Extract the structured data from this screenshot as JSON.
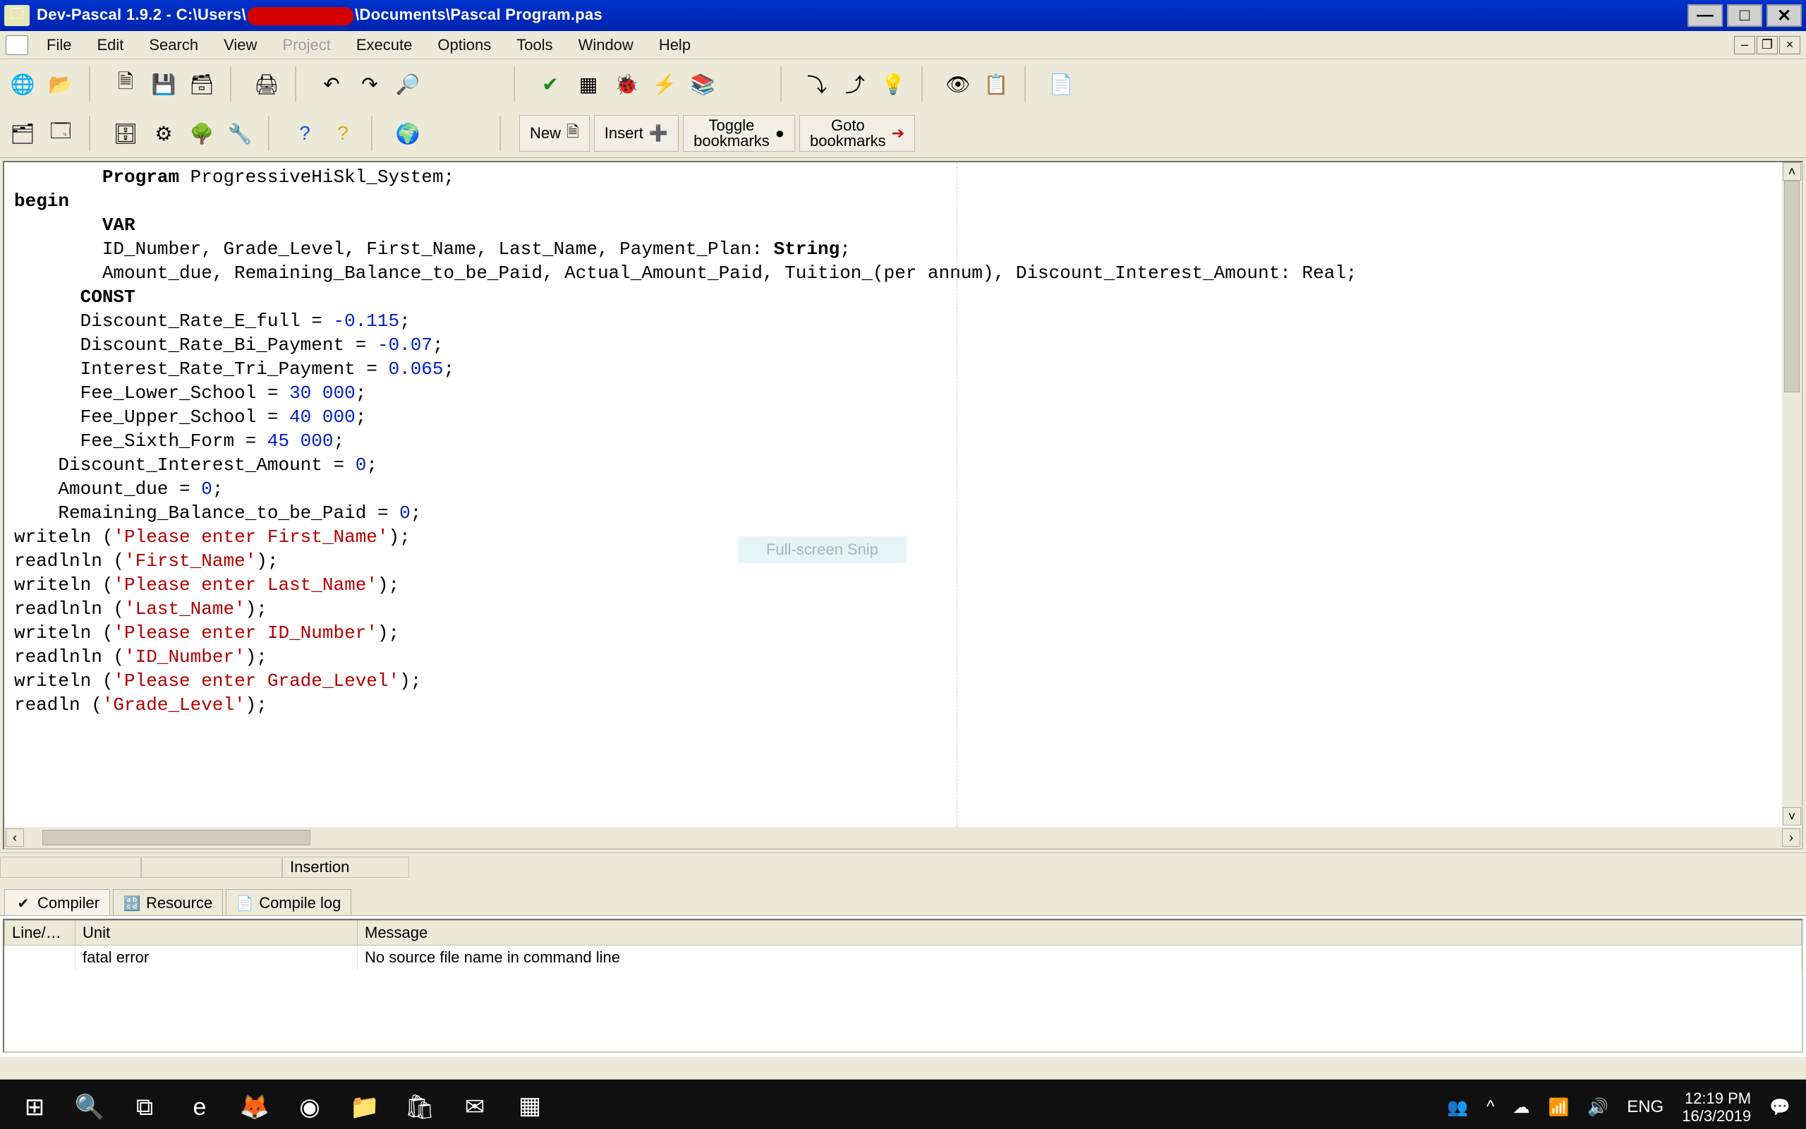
{
  "title": {
    "app": "Dev-Pascal 1.9.2",
    "path_prefix": " - C:\\Users\\",
    "path_suffix": "\\Documents\\Pascal Program.pas"
  },
  "menus": [
    "File",
    "Edit",
    "Search",
    "View",
    "Project",
    "Execute",
    "Options",
    "Tools",
    "Window",
    "Help"
  ],
  "menu_disabled_index": 4,
  "toolbar2": {
    "new": "New",
    "insert": "Insert",
    "toggle": "Toggle\nbookmarks",
    "goto": "Goto\nbookmarks"
  },
  "snip_hint": "Full-screen Snip",
  "status": {
    "mode": "Insertion"
  },
  "bottom_tabs": [
    {
      "icon": "✔",
      "label": "Compiler",
      "name": "tab-compiler"
    },
    {
      "icon": "🔡",
      "label": "Resource",
      "name": "tab-resource"
    },
    {
      "icon": "📄",
      "label": "Compile log",
      "name": "tab-compile-log"
    }
  ],
  "messages": {
    "columns": [
      "Line/…",
      "Unit",
      "Message"
    ],
    "rows": [
      {
        "line": "",
        "unit": "fatal error",
        "message": "No source file name in command line"
      }
    ]
  },
  "code_lines": [
    {
      "indent": 4,
      "tokens": [
        {
          "t": "Program ",
          "c": "kword"
        },
        {
          "t": "ProgressiveHiSkl_System;"
        }
      ]
    },
    {
      "indent": 0,
      "tokens": []
    },
    {
      "indent": 0,
      "tokens": [
        {
          "t": "begin",
          "c": "kword"
        }
      ]
    },
    {
      "indent": 0,
      "tokens": []
    },
    {
      "indent": 4,
      "tokens": [
        {
          "t": "VAR",
          "c": "kword"
        }
      ]
    },
    {
      "indent": 4,
      "tokens": [
        {
          "t": "ID_Number, Grade_Level, First_Name, Last_Name, Payment_Plan: "
        },
        {
          "t": "String",
          "c": "kword"
        },
        {
          "t": ";"
        }
      ]
    },
    {
      "indent": 4,
      "tokens": [
        {
          "t": "Amount_due, Remaining_Balance_to_be_Paid, Actual_Amount_Paid, Tuition_(per annum), Discount_Interest_Amount: Real;"
        }
      ]
    },
    {
      "indent": 0,
      "tokens": []
    },
    {
      "indent": 3,
      "tokens": [
        {
          "t": "CONST",
          "c": "kword"
        }
      ]
    },
    {
      "indent": 3,
      "tokens": [
        {
          "t": "Discount_Rate_E_full = "
        },
        {
          "t": "-0.115",
          "c": "num"
        },
        {
          "t": ";"
        }
      ]
    },
    {
      "indent": 3,
      "tokens": [
        {
          "t": "Discount_Rate_Bi_Payment = "
        },
        {
          "t": "-0.07",
          "c": "num"
        },
        {
          "t": ";"
        }
      ]
    },
    {
      "indent": 3,
      "tokens": [
        {
          "t": "Interest_Rate_Tri_Payment = "
        },
        {
          "t": "0.065",
          "c": "num"
        },
        {
          "t": ";"
        }
      ]
    },
    {
      "indent": 3,
      "tokens": [
        {
          "t": "Fee_Lower_School = "
        },
        {
          "t": "30 000",
          "c": "num"
        },
        {
          "t": ";"
        }
      ]
    },
    {
      "indent": 3,
      "tokens": [
        {
          "t": "Fee_Upper_School = "
        },
        {
          "t": "40 000",
          "c": "num"
        },
        {
          "t": ";"
        }
      ]
    },
    {
      "indent": 3,
      "tokens": [
        {
          "t": "Fee_Sixth_Form = "
        },
        {
          "t": "45 000",
          "c": "num"
        },
        {
          "t": ";"
        }
      ]
    },
    {
      "indent": 0,
      "tokens": []
    },
    {
      "indent": 2,
      "tokens": [
        {
          "t": "Discount_Interest_Amount = "
        },
        {
          "t": "0",
          "c": "num"
        },
        {
          "t": ";"
        }
      ]
    },
    {
      "indent": 2,
      "tokens": [
        {
          "t": "Amount_due = "
        },
        {
          "t": "0",
          "c": "num"
        },
        {
          "t": ";"
        }
      ]
    },
    {
      "indent": 2,
      "tokens": [
        {
          "t": "Remaining_Balance_to_be_Paid = "
        },
        {
          "t": "0",
          "c": "num"
        },
        {
          "t": ";"
        }
      ]
    },
    {
      "indent": 0,
      "tokens": []
    },
    {
      "indent": 0,
      "tokens": [
        {
          "t": "writeln ("
        },
        {
          "t": "'Please enter First_Name'",
          "c": "str"
        },
        {
          "t": ");"
        }
      ]
    },
    {
      "indent": 0,
      "tokens": [
        {
          "t": "readlnln ("
        },
        {
          "t": "'First_Name'",
          "c": "str"
        },
        {
          "t": ");"
        }
      ]
    },
    {
      "indent": 0,
      "tokens": [
        {
          "t": "writeln ("
        },
        {
          "t": "'Please enter Last_Name'",
          "c": "str"
        },
        {
          "t": ");"
        }
      ]
    },
    {
      "indent": 0,
      "tokens": [
        {
          "t": "readlnln ("
        },
        {
          "t": "'Last_Name'",
          "c": "str"
        },
        {
          "t": ");"
        }
      ]
    },
    {
      "indent": 0,
      "tokens": [
        {
          "t": "writeln ("
        },
        {
          "t": "'Please enter ID_Number'",
          "c": "str"
        },
        {
          "t": ");"
        }
      ]
    },
    {
      "indent": 0,
      "tokens": [
        {
          "t": "readlnln ("
        },
        {
          "t": "'ID_Number'",
          "c": "str"
        },
        {
          "t": ");"
        }
      ]
    },
    {
      "indent": 0,
      "tokens": [
        {
          "t": "writeln ("
        },
        {
          "t": "'Please enter Grade_Level'",
          "c": "str"
        },
        {
          "t": ");"
        }
      ]
    },
    {
      "indent": 0,
      "tokens": [
        {
          "t": "readln ("
        },
        {
          "t": "'Grade_Level'",
          "c": "str"
        },
        {
          "t": ");"
        }
      ]
    }
  ],
  "taskbar": {
    "apps": [
      {
        "name": "start-button",
        "glyph": "⊞"
      },
      {
        "name": "search-button",
        "glyph": "🔍"
      },
      {
        "name": "task-view-button",
        "glyph": "⧉"
      },
      {
        "name": "edge-app",
        "glyph": "e"
      },
      {
        "name": "firefox-app",
        "glyph": "🦊"
      },
      {
        "name": "chrome-app",
        "glyph": "◉"
      },
      {
        "name": "explorer-app",
        "glyph": "📁"
      },
      {
        "name": "store-app",
        "glyph": "🛍"
      },
      {
        "name": "mail-app",
        "glyph": "✉"
      },
      {
        "name": "devpascal-app",
        "glyph": "▦",
        "active": true
      }
    ],
    "tray": {
      "people": "👥",
      "up": "^",
      "cloud": "☁",
      "wifi": "📶",
      "sound": "🔊",
      "lang": "ENG",
      "time": "12:19 PM",
      "date": "16/3/2019",
      "notif": "💬"
    }
  }
}
